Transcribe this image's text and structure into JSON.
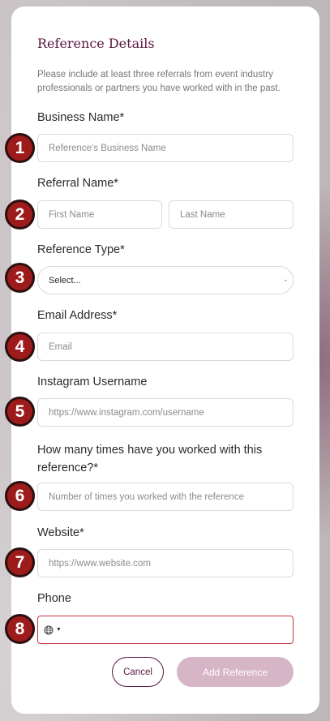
{
  "form": {
    "title": "Reference Details",
    "intro": "Please include at least three referrals from event industry professionals or partners you have worked with in the past.",
    "business_name": {
      "label": "Business Name*",
      "placeholder": "Reference's Business Name"
    },
    "referral_name": {
      "label": "Referral Name*",
      "first_placeholder": "First Name",
      "last_placeholder": "Last Name"
    },
    "reference_type": {
      "label": "Reference Type*",
      "value": "Select..."
    },
    "email": {
      "label": "Email Address*",
      "placeholder": "Email"
    },
    "instagram": {
      "label": "Instagram Username",
      "placeholder": "https://www.instagram.com/username"
    },
    "times_worked": {
      "label": "How many times have you worked with this reference?*",
      "placeholder": "Number of times you worked with the reference"
    },
    "website": {
      "label": "Website*",
      "placeholder": "https://www.website.com"
    },
    "phone": {
      "label": "Phone",
      "country_icon": "globe-icon",
      "value": ""
    },
    "buttons": {
      "cancel": "Cancel",
      "add": "Add Reference"
    }
  },
  "badges": [
    "1",
    "2",
    "3",
    "4",
    "5",
    "6",
    "7",
    "8"
  ],
  "colors": {
    "brand": "#5a1640",
    "add_button_disabled": "#d6b6c6",
    "badge": "#9e1b1b",
    "phone_error_border": "#c8323a"
  }
}
